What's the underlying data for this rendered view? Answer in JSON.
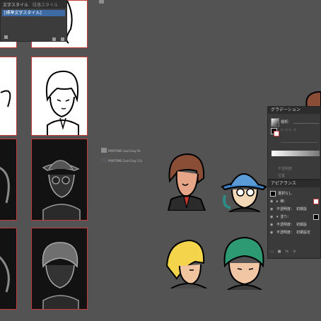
{
  "character_style_panel": {
    "tab_active": "文字スタイル",
    "tab_inactive": "段落スタイル",
    "item": "[標準文字スタイル]"
  },
  "swatches": [
    {
      "name": "PANTONE Cool Gray 9c",
      "color": "#8d8e90"
    },
    {
      "name": "PANTONE Cool Gray 11c",
      "color": "#56595e"
    }
  ],
  "gradient_panel": {
    "title": "グラデーション",
    "type_label": "種類：",
    "opacity_label": "不透明度",
    "location_label": "位置"
  },
  "appearance_panel": {
    "title": "アピアランス",
    "object_label": "選択なし",
    "stroke_label": "線：",
    "opacity_label": "不透明度：",
    "opacity_value": "初期設",
    "fill_label": "塗り：",
    "fill_opacity_label": "不透明度：",
    "fill_opacity_value": "初期設",
    "bottom_opacity_label": "不透明度：",
    "bottom_opacity_value": "初期設定"
  },
  "colors": {
    "artboard_border": "#c23a3a",
    "canvas": "#535353",
    "selection_blue": "#3d6aa3"
  }
}
